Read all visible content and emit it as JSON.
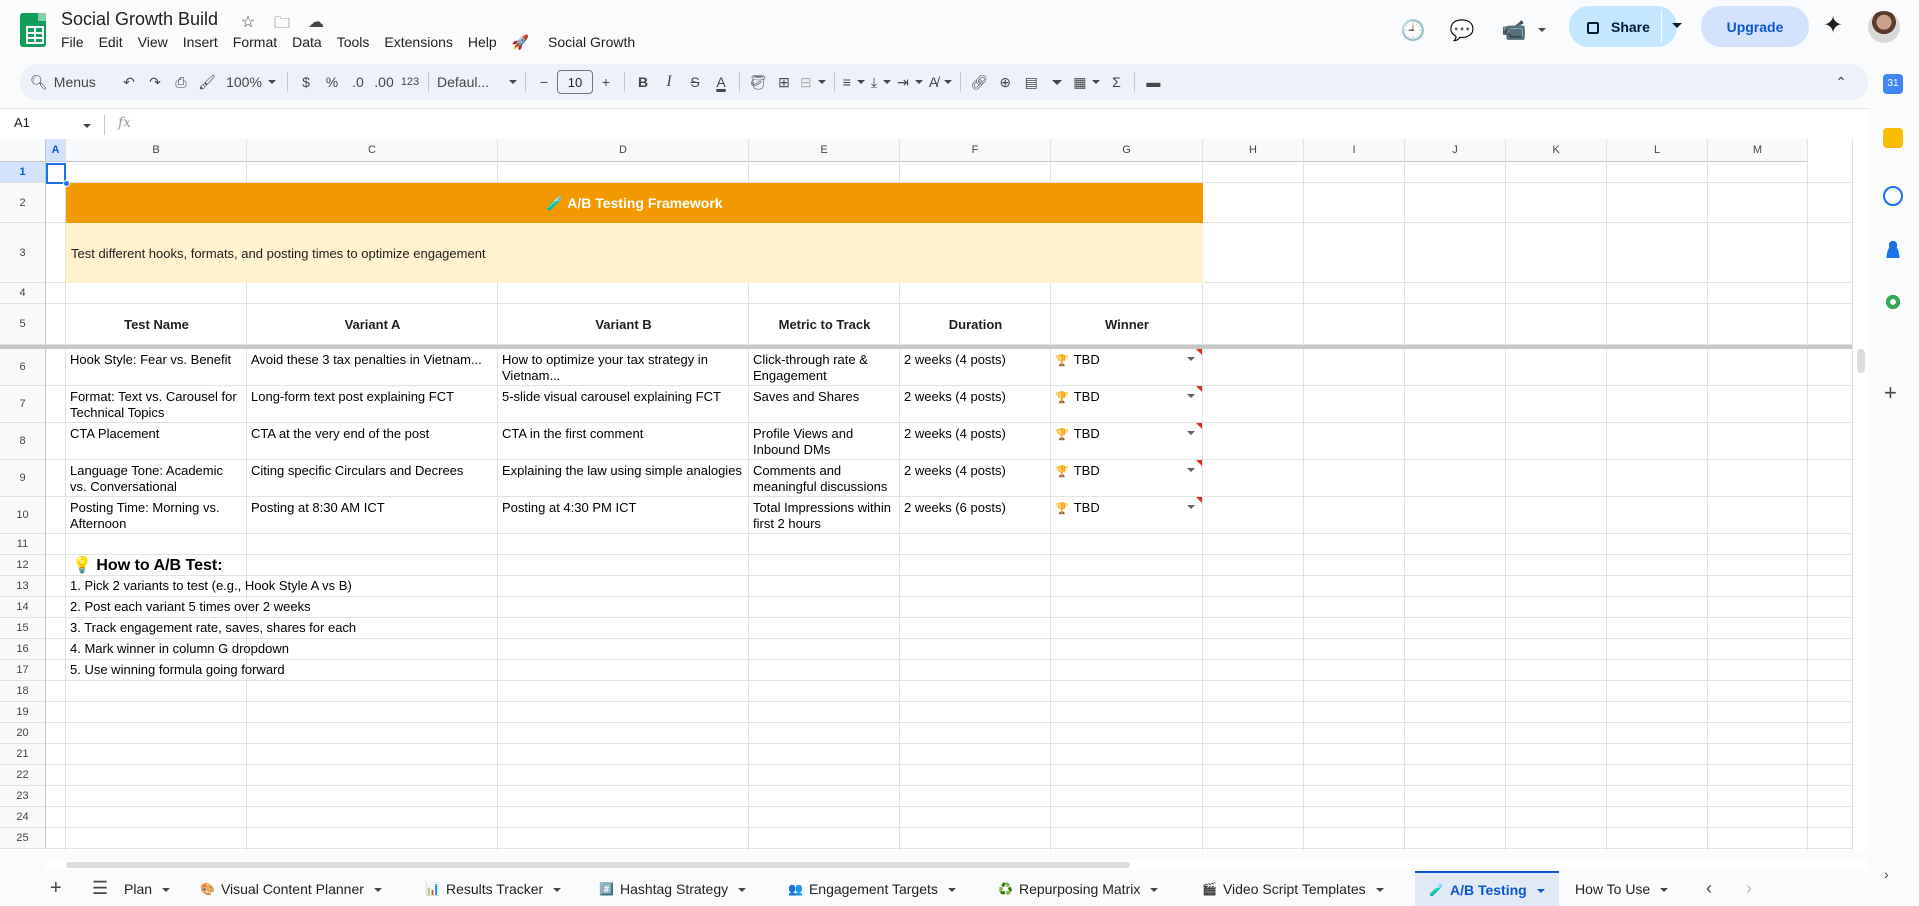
{
  "app": {
    "doc_title": "Social Growth Build",
    "menus": [
      "File",
      "Edit",
      "View",
      "Insert",
      "Format",
      "Data",
      "Tools",
      "Extensions",
      "Help"
    ],
    "extension_menu": "Social Growth",
    "share_label": "Share",
    "upgrade_label": "Upgrade"
  },
  "toolbar": {
    "menus_label": "Menus",
    "zoom": "100%",
    "currency": "$",
    "percent": "%",
    "dec_decrease": ".0",
    "dec_increase": ".00",
    "number_format": "123",
    "font": "Defaul...",
    "font_size": "10",
    "bold": "B",
    "italic": "I",
    "strike": "S",
    "textcolor": "A"
  },
  "formula_bar": {
    "cell_ref": "A1",
    "fx": "fx"
  },
  "grid": {
    "columns": [
      "A",
      "B",
      "C",
      "D",
      "E",
      "F",
      "G",
      "H",
      "I",
      "J",
      "K",
      "L",
      "M"
    ],
    "rows": [
      "1",
      "2",
      "3",
      "4",
      "5",
      "6",
      "7",
      "8",
      "9",
      "10",
      "11",
      "12",
      "13",
      "14",
      "15",
      "16",
      "17",
      "18",
      "19",
      "20",
      "21",
      "22",
      "23",
      "24",
      "25"
    ],
    "banner": "🧪 A/B Testing Framework",
    "subtitle": "Test different hooks, formats, and posting times to optimize engagement",
    "headers": [
      "Test Name",
      "Variant A",
      "Variant B",
      "Metric to Track",
      "Duration",
      "Winner"
    ],
    "tests": [
      {
        "name": "Hook Style: Fear vs. Benefit",
        "a": "Avoid these 3 tax penalties in Vietnam...",
        "b": "How to optimize your tax strategy in Vietnam...",
        "metric": "Click-through rate & Engagement",
        "duration": "2 weeks (4 posts)",
        "winner": "TBD"
      },
      {
        "name": "Format: Text vs. Carousel for Technical Topics",
        "a": "Long-form text post explaining FCT",
        "b": "5-slide visual carousel explaining FCT",
        "metric": "Saves and Shares",
        "duration": "2 weeks (4 posts)",
        "winner": "TBD"
      },
      {
        "name": "CTA Placement",
        "a": "CTA at the very end of the post",
        "b": "CTA in the first comment",
        "metric": "Profile Views and Inbound DMs",
        "duration": "2 weeks (4 posts)",
        "winner": "TBD"
      },
      {
        "name": "Language Tone: Academic vs. Conversational",
        "a": "Citing specific Circulars and Decrees",
        "b": "Explaining the law using simple analogies",
        "metric": "Comments and meaningful discussions",
        "duration": "2 weeks (4 posts)",
        "winner": "TBD"
      },
      {
        "name": "Posting Time: Morning vs. Afternoon",
        "a": "Posting at 8:30 AM ICT",
        "b": "Posting at 4:30 PM ICT",
        "metric": "Total Impressions within first 2 hours",
        "duration": "2 weeks (6 posts)",
        "winner": "TBD"
      }
    ],
    "winner_icon": "🏆",
    "how_title": "💡  How to A/B Test:",
    "how_steps": [
      "1. Pick 2 variants to test (e.g., Hook Style A vs B)",
      "2. Post each variant 5 times over 2 weeks",
      "3. Track engagement rate, saves, shares for each",
      "4. Mark winner in column G dropdown",
      "5. Use winning formula going forward"
    ]
  },
  "tabs": [
    {
      "glyph": "",
      "label": "Plan"
    },
    {
      "glyph": "🎨",
      "label": "Visual Content Planner"
    },
    {
      "glyph": "📊",
      "label": "Results Tracker"
    },
    {
      "glyph": "#️⃣",
      "label": "Hashtag Strategy"
    },
    {
      "glyph": "👥",
      "label": "Engagement Targets"
    },
    {
      "glyph": "♻️",
      "label": "Repurposing Matrix"
    },
    {
      "glyph": "🎬",
      "label": "Video Script Templates"
    },
    {
      "glyph": "🧪",
      "label": "A/B Testing"
    },
    {
      "glyph": "",
      "label": "How To Use"
    }
  ],
  "colors": {
    "banner": "#f29900",
    "subtitle_bg": "#fff2cc",
    "accent": "#0b57d0"
  }
}
